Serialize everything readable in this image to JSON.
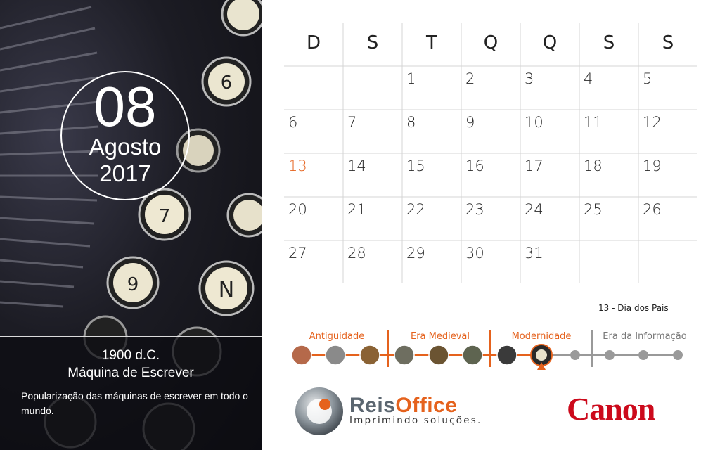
{
  "date": {
    "day": "08",
    "month": "Agosto",
    "year": "2017"
  },
  "caption": {
    "title": "1900 d.C.",
    "subtitle": "Máquina de Escrever",
    "description": "Popularização das máquinas de escrever em todo o mundo."
  },
  "calendar": {
    "weekdays": [
      "D",
      "S",
      "T",
      "Q",
      "Q",
      "S",
      "S"
    ],
    "weeks": [
      [
        "",
        "",
        "1",
        "2",
        "3",
        "4",
        "5"
      ],
      [
        "6",
        "7",
        "8",
        "9",
        "10",
        "11",
        "12"
      ],
      [
        "13",
        "14",
        "15",
        "16",
        "17",
        "18",
        "19"
      ],
      [
        "20",
        "21",
        "22",
        "23",
        "24",
        "25",
        "26"
      ],
      [
        "27",
        "28",
        "29",
        "30",
        "31",
        "",
        ""
      ]
    ],
    "highlight_color": "#e5621d"
  },
  "holiday_note": "13 - Dia dos Pais",
  "timeline": {
    "eras": [
      "Antiguidade",
      "Era Medieval",
      "Modernidade",
      "Era da Informação"
    ],
    "accent_color": "#e5621d"
  },
  "brand": {
    "reis_part1": "Reis",
    "reis_part2": "Office",
    "reis_tagline": "Imprimindo soluções.",
    "canon": "Canon",
    "canon_color": "#cc0a1c"
  }
}
